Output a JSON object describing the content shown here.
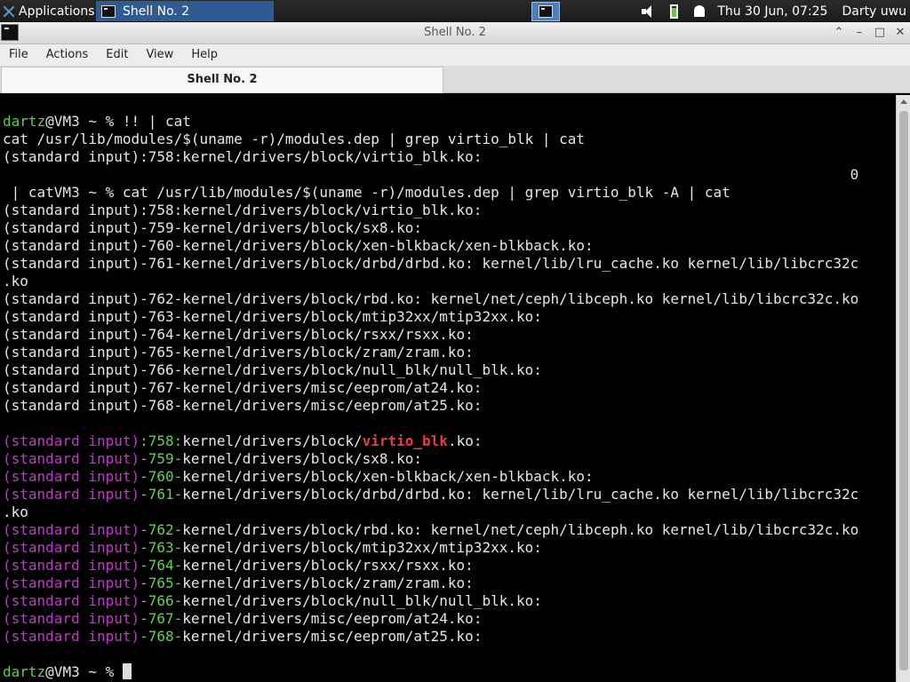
{
  "panel": {
    "apps_label": "Applications",
    "task_label": "Shell No. 2",
    "clock": "Thu 30 Jun, 07:25",
    "user": "Darty uwu"
  },
  "window": {
    "title": "Shell No. 2",
    "minimize": "⌃",
    "restore": "–",
    "maximize": "□",
    "close": "✕"
  },
  "menu": [
    "File",
    "Actions",
    "Edit",
    "View",
    "Help"
  ],
  "tab": {
    "label": "Shell No. 2"
  },
  "terminal": {
    "lines": [
      [
        {
          "t": "dartz",
          "c": "user"
        },
        {
          "t": "@VM3 ~ % !! | cat"
        }
      ],
      [
        {
          "t": "cat /usr/lib/modules/$(uname -r)/modules.dep | grep virtio_blk | cat"
        }
      ],
      [
        {
          "t": "(standard input):758:kernel/drivers/block/virtio_blk.ko:"
        }
      ],
      [
        {
          "t": "                                                                                                   0"
        }
      ],
      [
        {
          "t": " | catVM3 ~ % cat /usr/lib/modules/$(uname -r)/modules.dep | grep virtio_blk -A | cat"
        }
      ],
      [
        {
          "t": "(standard input):758:kernel/drivers/block/virtio_blk.ko:"
        }
      ],
      [
        {
          "t": "(standard input)-759-kernel/drivers/block/sx8.ko:"
        }
      ],
      [
        {
          "t": "(standard input)-760-kernel/drivers/block/xen-blkback/xen-blkback.ko:"
        }
      ],
      [
        {
          "t": "(standard input)-761-kernel/drivers/block/drbd/drbd.ko: kernel/lib/lru_cache.ko kernel/lib/libcrc32c"
        }
      ],
      [
        {
          "t": ".ko"
        }
      ],
      [
        {
          "t": "(standard input)-762-kernel/drivers/block/rbd.ko: kernel/net/ceph/libceph.ko kernel/lib/libcrc32c.ko"
        }
      ],
      [
        {
          "t": "(standard input)-763-kernel/drivers/block/mtip32xx/mtip32xx.ko:"
        }
      ],
      [
        {
          "t": "(standard input)-764-kernel/drivers/block/rsxx/rsxx.ko:"
        }
      ],
      [
        {
          "t": "(standard input)-765-kernel/drivers/block/zram/zram.ko:"
        }
      ],
      [
        {
          "t": "(standard input)-766-kernel/drivers/block/null_blk/null_blk.ko:"
        }
      ],
      [
        {
          "t": "(standard input)-767-kernel/drivers/misc/eeprom/at24.ko:"
        }
      ],
      [
        {
          "t": "(standard input)-768-kernel/drivers/misc/eeprom/at25.ko:"
        }
      ],
      [],
      [
        {
          "t": "(standard input)",
          "c": "mag"
        },
        {
          "t": ":",
          "c": "grn"
        },
        {
          "t": "758",
          "c": "grn"
        },
        {
          "t": ":",
          "c": "grn"
        },
        {
          "t": "kernel/drivers/block/"
        },
        {
          "t": "virtio_blk",
          "c": "red"
        },
        {
          "t": ".ko:"
        }
      ],
      [
        {
          "t": "(standard input)",
          "c": "mag"
        },
        {
          "t": "-759-",
          "c": "grn"
        },
        {
          "t": "kernel/drivers/block/sx8.ko:"
        }
      ],
      [
        {
          "t": "(standard input)",
          "c": "mag"
        },
        {
          "t": "-760-",
          "c": "grn"
        },
        {
          "t": "kernel/drivers/block/xen-blkback/xen-blkback.ko:"
        }
      ],
      [
        {
          "t": "(standard input)",
          "c": "mag"
        },
        {
          "t": "-761-",
          "c": "grn"
        },
        {
          "t": "kernel/drivers/block/drbd/drbd.ko: kernel/lib/lru_cache.ko kernel/lib/libcrc32c"
        }
      ],
      [
        {
          "t": ".ko"
        }
      ],
      [
        {
          "t": "(standard input)",
          "c": "mag"
        },
        {
          "t": "-762-",
          "c": "grn"
        },
        {
          "t": "kernel/drivers/block/rbd.ko: kernel/net/ceph/libceph.ko kernel/lib/libcrc32c.ko"
        }
      ],
      [
        {
          "t": "(standard input)",
          "c": "mag"
        },
        {
          "t": "-763-",
          "c": "grn"
        },
        {
          "t": "kernel/drivers/block/mtip32xx/mtip32xx.ko:"
        }
      ],
      [
        {
          "t": "(standard input)",
          "c": "mag"
        },
        {
          "t": "-764-",
          "c": "grn"
        },
        {
          "t": "kernel/drivers/block/rsxx/rsxx.ko:"
        }
      ],
      [
        {
          "t": "(standard input)",
          "c": "mag"
        },
        {
          "t": "-765-",
          "c": "grn"
        },
        {
          "t": "kernel/drivers/block/zram/zram.ko:"
        }
      ],
      [
        {
          "t": "(standard input)",
          "c": "mag"
        },
        {
          "t": "-766-",
          "c": "grn"
        },
        {
          "t": "kernel/drivers/block/null_blk/null_blk.ko:"
        }
      ],
      [
        {
          "t": "(standard input)",
          "c": "mag"
        },
        {
          "t": "-767-",
          "c": "grn"
        },
        {
          "t": "kernel/drivers/misc/eeprom/at24.ko:"
        }
      ],
      [
        {
          "t": "(standard input)",
          "c": "mag"
        },
        {
          "t": "-768-",
          "c": "grn"
        },
        {
          "t": "kernel/drivers/misc/eeprom/at25.ko:"
        }
      ],
      [],
      [
        {
          "t": "dartz",
          "c": "user"
        },
        {
          "t": "@VM3 ~ % "
        }
      ]
    ]
  },
  "colors": {
    "user": "#59d14a",
    "filename": "#c23ac9",
    "line_number": "#5fd44d",
    "match": "#ef3b3b",
    "text": "#e6e6e6",
    "accent": "#4a90d9"
  },
  "icons": {
    "apps": "xfce-logo-icon",
    "terminal": "terminal-icon",
    "volume": "volume-icon",
    "battery": "battery-icon",
    "notifications": "bell-icon"
  }
}
